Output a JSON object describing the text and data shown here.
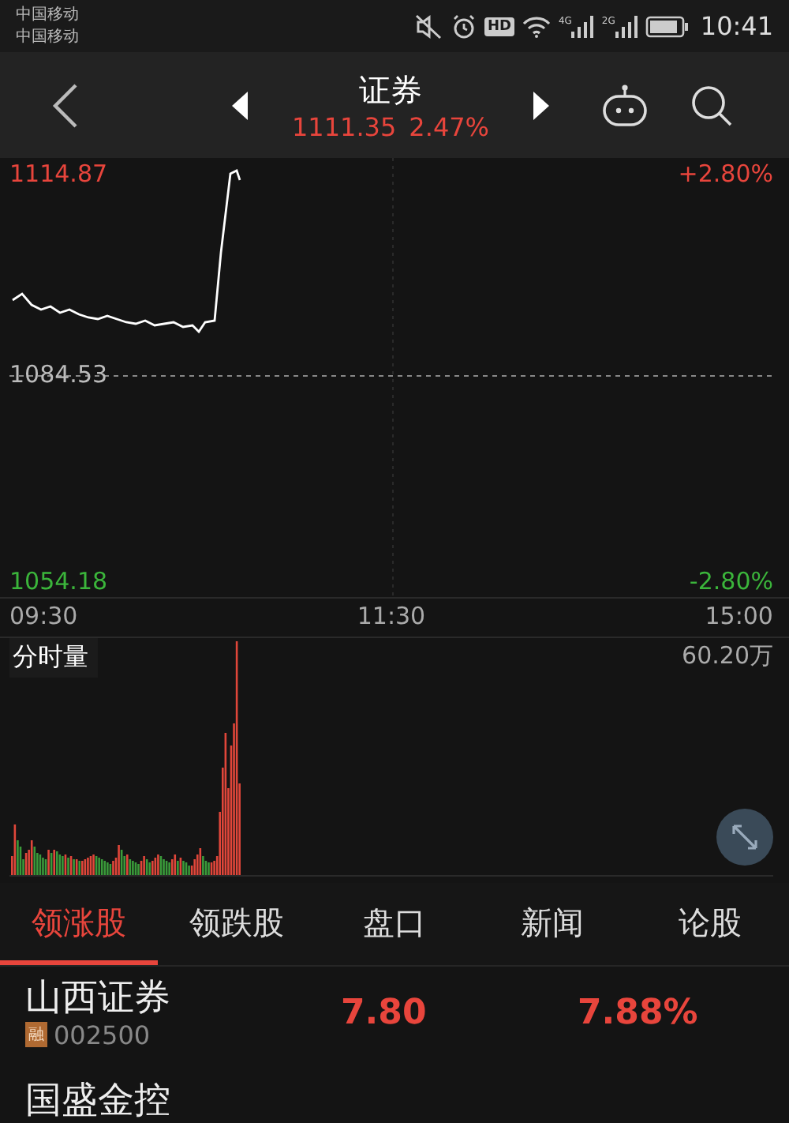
{
  "status_bar": {
    "carriers": [
      "中国移动",
      "中国移动"
    ],
    "hd": "HD",
    "networks": [
      "4G",
      "2G"
    ],
    "time": "10:41"
  },
  "header": {
    "title": "证券",
    "price": "1111.35",
    "change": "2.47%"
  },
  "price_chart": {
    "high": "1114.87",
    "mid": "1084.53",
    "low": "1054.18",
    "high_pct": "+2.80%",
    "low_pct": "-2.80%",
    "times": [
      "09:30",
      "11:30",
      "15:00"
    ]
  },
  "volume": {
    "title": "分时量",
    "max": "60.20万"
  },
  "tabs": [
    {
      "label": "领涨股",
      "selected": true
    },
    {
      "label": "领跌股",
      "selected": false
    },
    {
      "label": "盘口",
      "selected": false
    },
    {
      "label": "新闻",
      "selected": false
    },
    {
      "label": "论股",
      "selected": false
    }
  ],
  "stocks": [
    {
      "name": "山西证券",
      "badge": "融",
      "code": "002500",
      "price": "7.80",
      "change": "7.88%"
    },
    {
      "name": "国盛金控"
    }
  ]
}
